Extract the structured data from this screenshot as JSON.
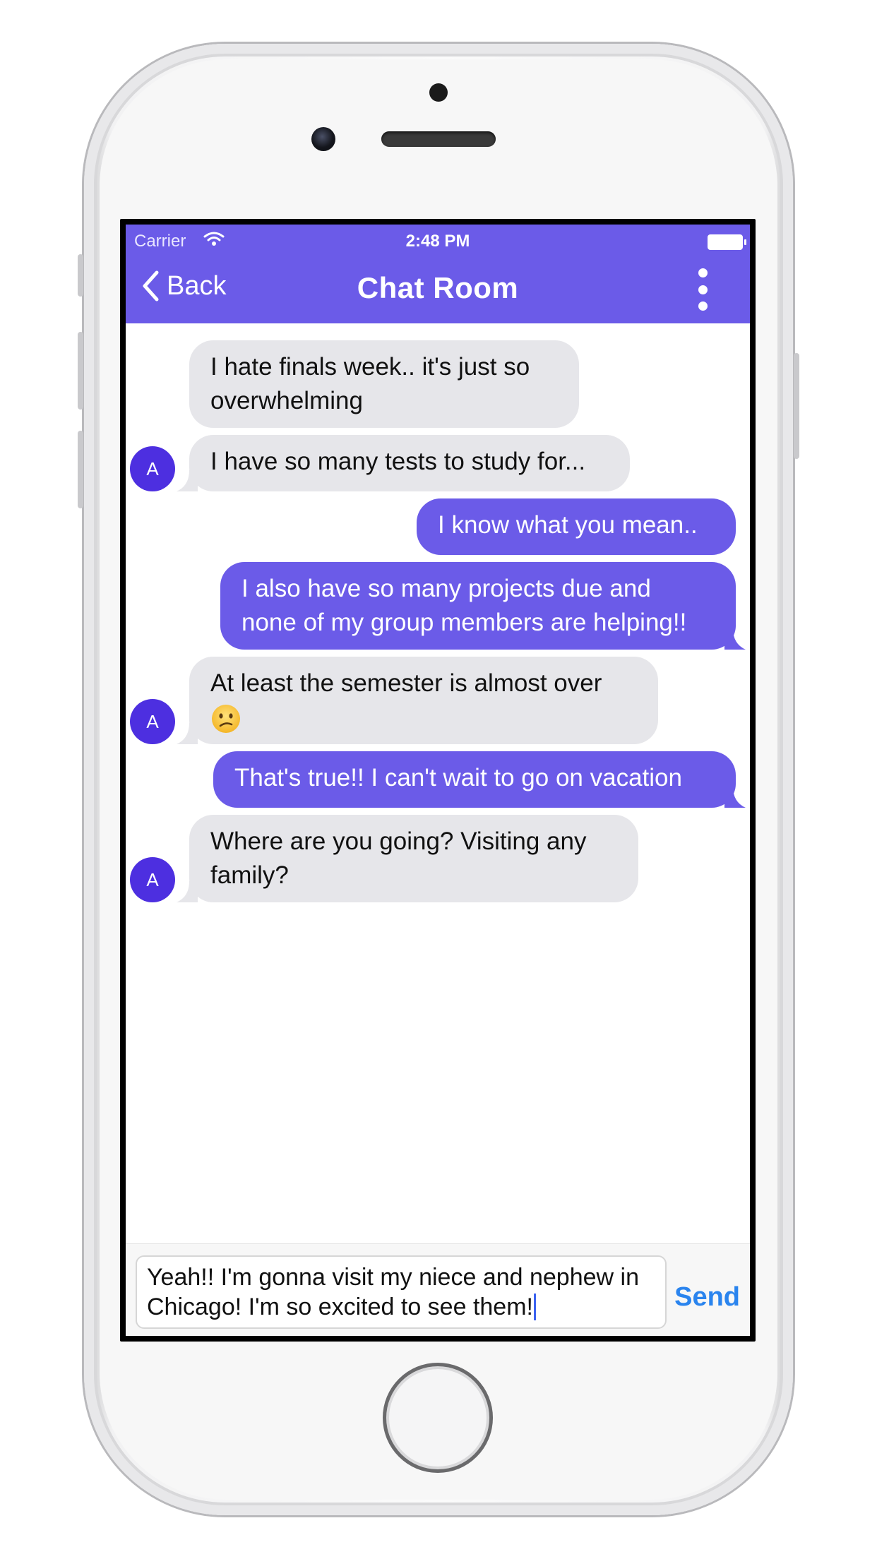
{
  "status_bar": {
    "carrier": "Carrier",
    "time": "2:48 PM"
  },
  "nav": {
    "back_label": "Back",
    "title": "Chat Room"
  },
  "messages": [
    {
      "from": "them",
      "lines": [
        "I hate finals week.. it's just so",
        "overwhelming"
      ]
    },
    {
      "from": "them",
      "lines": [
        "I have so many tests to study for..."
      ],
      "avatar": "A"
    },
    {
      "from": "me",
      "lines": [
        "I know what you mean.."
      ]
    },
    {
      "from": "me",
      "lines": [
        "I also have so many projects due and",
        "none of my group members are helping!!"
      ]
    },
    {
      "from": "them",
      "lines": [
        "At least the semester is almost over",
        ""
      ],
      "emoji": "confused-face",
      "avatar": "A"
    },
    {
      "from": "me",
      "lines": [
        "That's true!! I can't wait to go on vacation"
      ]
    },
    {
      "from": "them",
      "lines": [
        "Where are you going? Visiting any",
        "family?"
      ],
      "avatar": "A"
    }
  ],
  "composer": {
    "draft_line1": "Yeah!! I'm gonna visit my niece and nephew in",
    "draft_line2": "Chicago! I'm so excited to see them!",
    "send_label": "Send"
  },
  "colors": {
    "accent": "#6b5be8",
    "incoming": "#e6e6ea",
    "avatar": "#4d2fe0",
    "send": "#2a84ee"
  }
}
